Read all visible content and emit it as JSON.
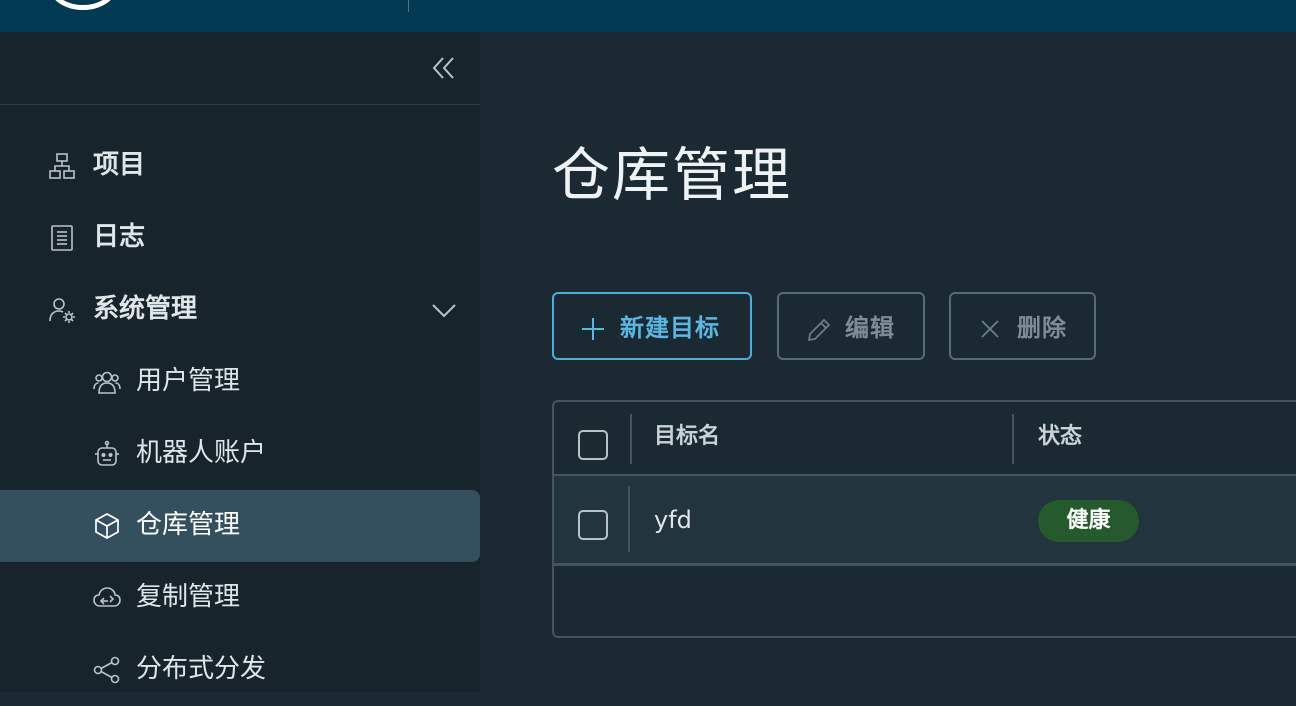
{
  "sidebar": {
    "items": [
      {
        "label": "项目",
        "icon": "project-icon"
      },
      {
        "label": "日志",
        "icon": "log-icon"
      },
      {
        "label": "系统管理",
        "icon": "admin-icon"
      },
      {
        "label": "用户管理",
        "icon": "users-icon"
      },
      {
        "label": "机器人账户",
        "icon": "robot-icon"
      },
      {
        "label": "仓库管理",
        "icon": "registry-icon"
      },
      {
        "label": "复制管理",
        "icon": "replication-icon"
      },
      {
        "label": "分布式分发",
        "icon": "distribution-icon"
      }
    ],
    "active": "仓库管理"
  },
  "main": {
    "title": "仓库管理",
    "toolbar": {
      "new_label": "新建目标",
      "edit_label": "编辑",
      "delete_label": "删除"
    },
    "table": {
      "columns": [
        "目标名",
        "状态"
      ],
      "rows": [
        {
          "name": "yfd",
          "status": "健康"
        }
      ]
    }
  },
  "colors": {
    "header_bg": "#013a52",
    "sidebar_bg": "#17242b",
    "active_bg": "#34505f",
    "accent": "#49aedb",
    "healthy_badge": "#255a2c"
  }
}
